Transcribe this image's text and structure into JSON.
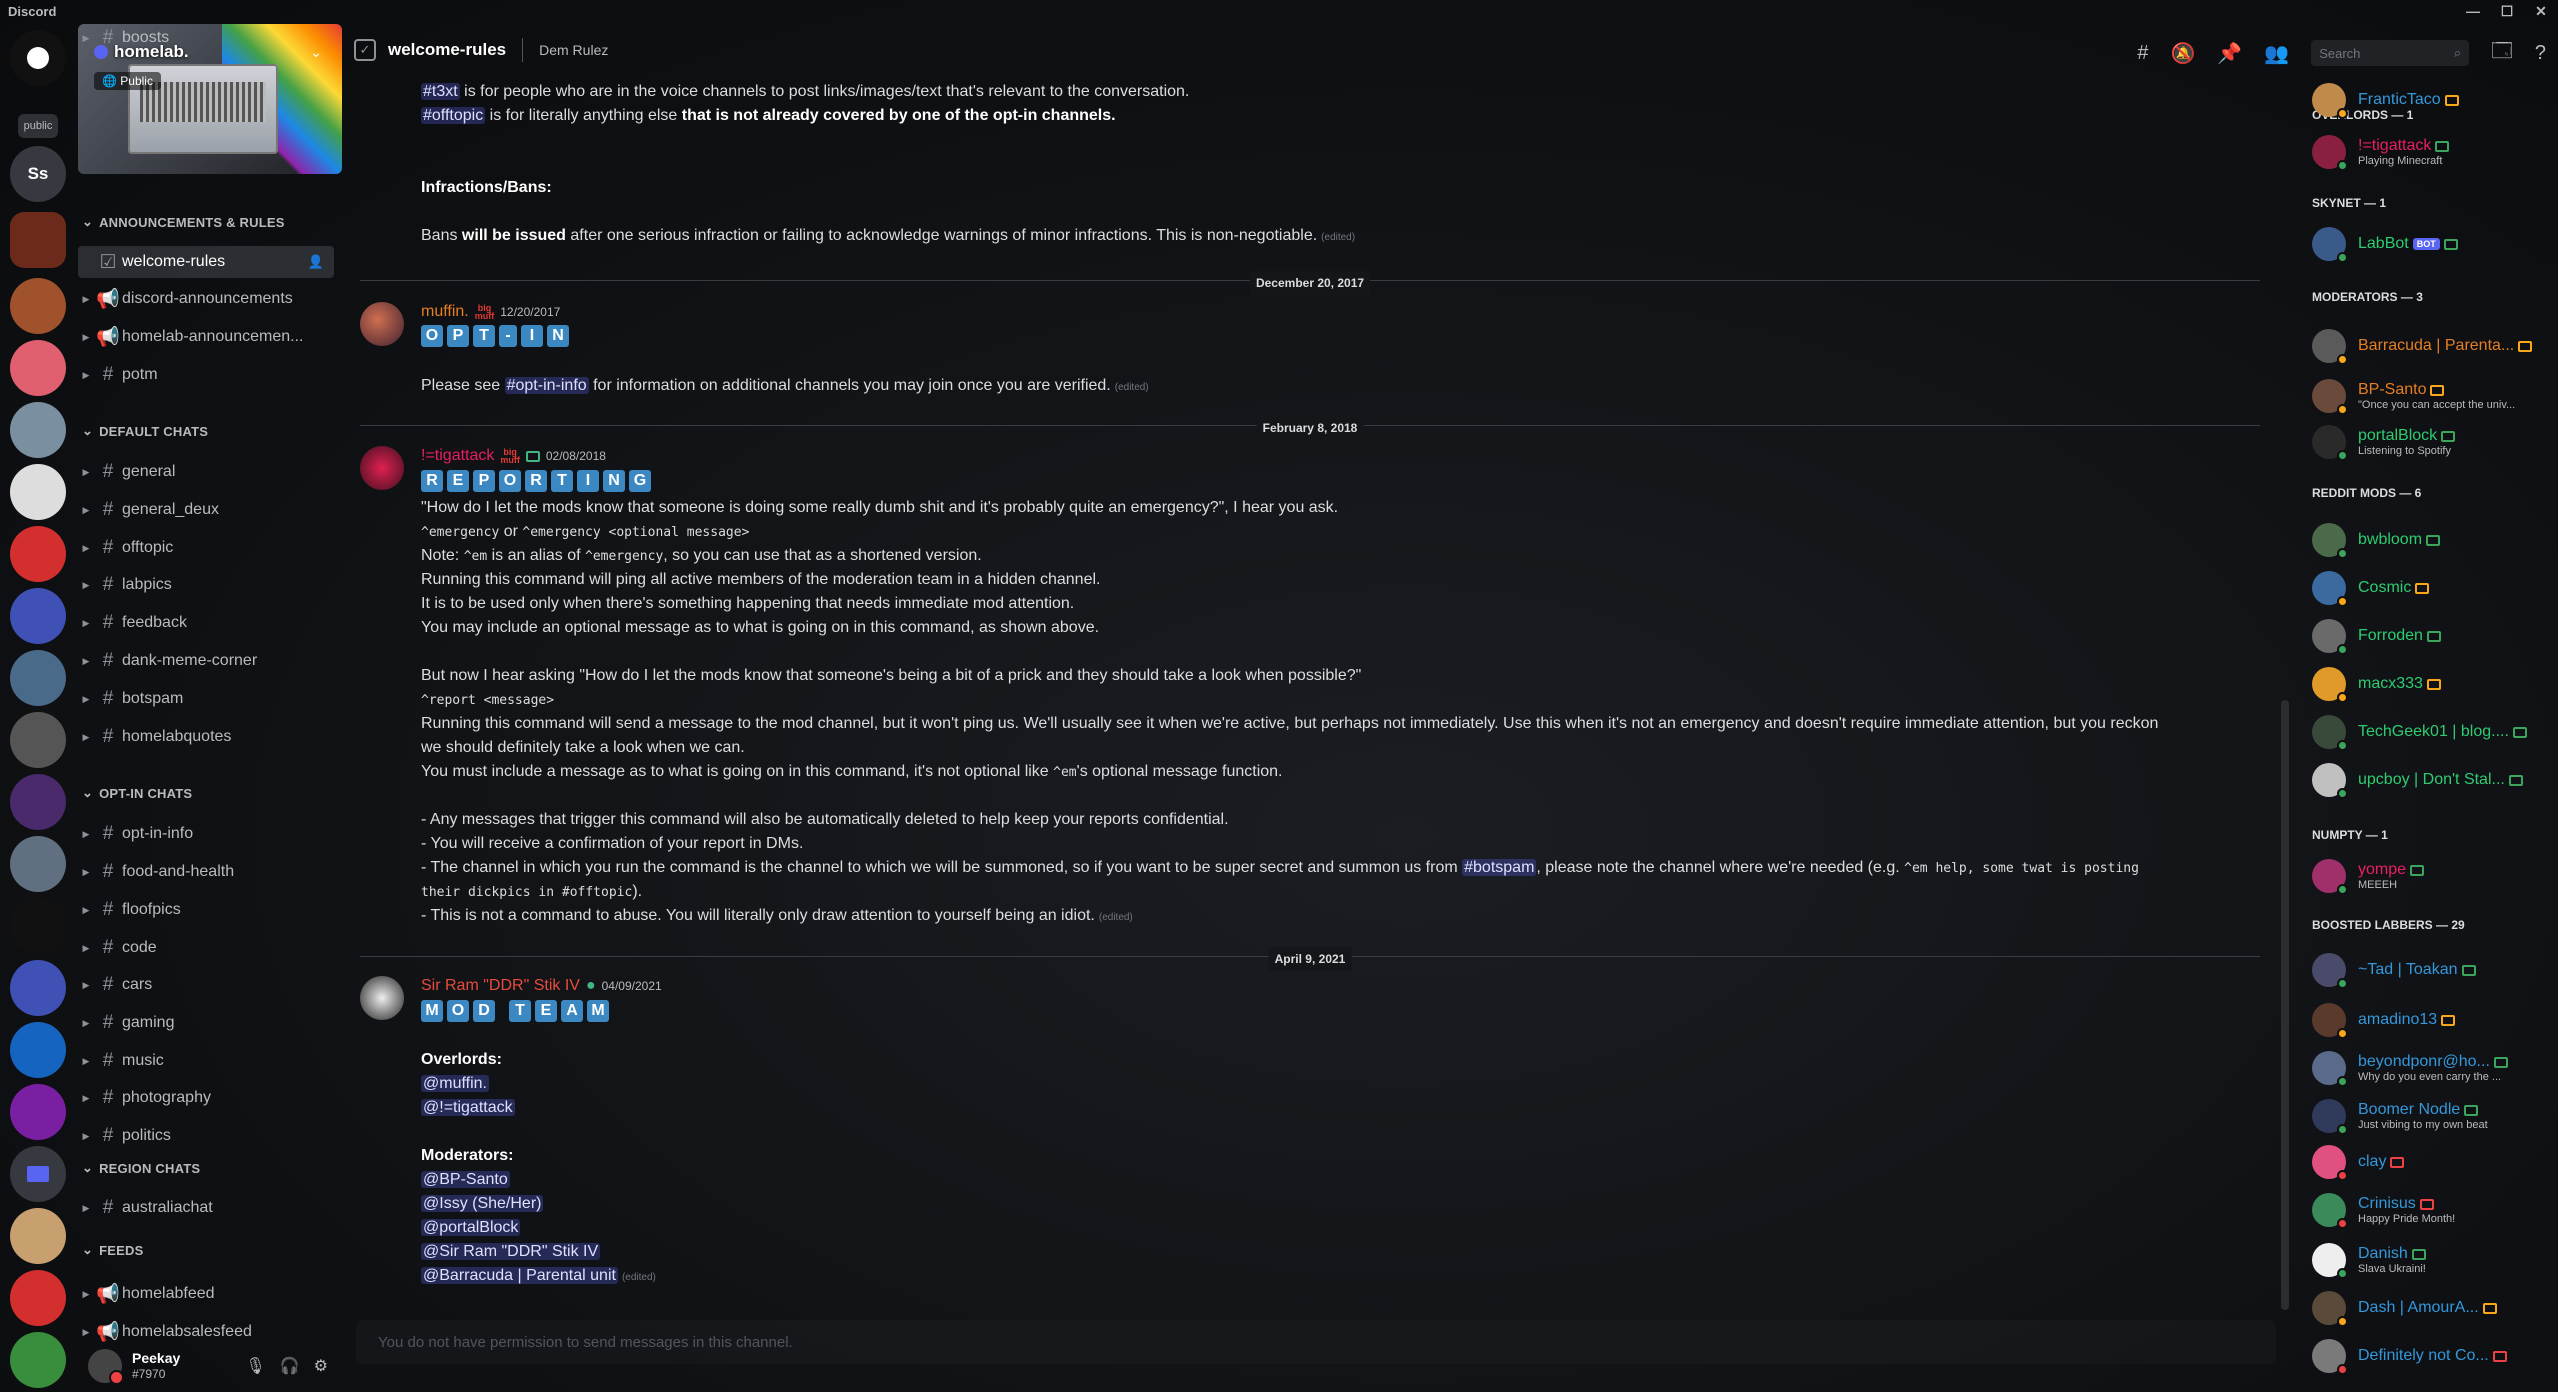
{
  "app": {
    "title": "Discord",
    "controls": [
      "—",
      "☐",
      "✕"
    ]
  },
  "rail": {
    "public_badge": "public",
    "initials_server": "Ss"
  },
  "server": {
    "name": "homelab.",
    "public_label": "Public"
  },
  "categories": [
    {
      "label": "ANNOUNCEMENTS & RULES",
      "channels": [
        {
          "name": "welcome-rules",
          "type": "rules",
          "active": true
        },
        {
          "name": "discord-announcements",
          "type": "announce"
        },
        {
          "name": "homelab-announcemen...",
          "type": "announce"
        },
        {
          "name": "potm",
          "type": "text"
        },
        {
          "name": "boosts",
          "type": "text"
        }
      ]
    },
    {
      "label": "DEFAULT CHATS",
      "channels": [
        {
          "name": "general"
        },
        {
          "name": "general_deux"
        },
        {
          "name": "offtopic"
        },
        {
          "name": "labpics"
        },
        {
          "name": "feedback"
        },
        {
          "name": "dank-meme-corner"
        },
        {
          "name": "botspam"
        },
        {
          "name": "homelabquotes"
        }
      ]
    },
    {
      "label": "OPT-IN CHATS",
      "channels": [
        {
          "name": "opt-in-info"
        },
        {
          "name": "food-and-health"
        },
        {
          "name": "floofpics"
        },
        {
          "name": "code"
        },
        {
          "name": "cars"
        },
        {
          "name": "gaming"
        },
        {
          "name": "music"
        },
        {
          "name": "photography"
        },
        {
          "name": "politics"
        }
      ]
    },
    {
      "label": "REGION CHATS",
      "channels": [
        {
          "name": "australiachat"
        }
      ]
    },
    {
      "label": "FEEDS",
      "channels": [
        {
          "name": "homelabfeed"
        },
        {
          "name": "homelabsalesfeed"
        }
      ]
    }
  ],
  "user": {
    "name": "Peekay",
    "tag": "#7970"
  },
  "header": {
    "channel": "welcome-rules",
    "topic": "Dem Rulez",
    "search_placeholder": "Search"
  },
  "messages": {
    "top": {
      "l1_mention": "#t3xt",
      "l1_text": " is for people who are in the voice channels to post links/images/text that's relevant to the conversation.",
      "l2_mention": "#offtopic",
      "l2_text": " is for literally anything else ",
      "l2_bold": "that is not already covered by one of the opt-in channels.",
      "infractions_heading": "Infractions/Bans:",
      "bans_a": "Bans ",
      "bans_b": "will be issued",
      "bans_c": " after one serious infraction or failing to acknowledge warnings of minor infractions. This is non-negotiable.",
      "edited": "(edited)"
    },
    "dates": [
      "December 20, 2017",
      "February 8, 2018",
      "April 9, 2021"
    ],
    "optin": {
      "author": "muffin.",
      "author_color": "#e67e22",
      "timestamp": "12/20/2017",
      "tiles": [
        "O",
        "P",
        "T",
        "-",
        "I",
        "N"
      ],
      "text_a": "Please see ",
      "mention": "#opt-in-info",
      "text_b": " for information on additional channels you may join once you are verified.",
      "edited": "(edited)"
    },
    "reporting": {
      "author": "!=tigattack",
      "author_color": "#e91e63",
      "timestamp": "02/08/2018",
      "tiles": [
        "R",
        "E",
        "P",
        "O",
        "R",
        "T",
        "I",
        "N",
        "G"
      ],
      "l1": "\"How do I let the mods know that someone is doing some really dumb shit and it's probably quite an emergency?\", I hear you ask.",
      "l2_code": "^emergency",
      "l2_or": " or ",
      "l2_code2": "^emergency <optional message>",
      "l3_a": "Note: ",
      "l3_code": "^em",
      "l3_b": " is an alias of ",
      "l3_code2": "^emergency",
      "l3_c": ", so you can use that as a shortened version.",
      "l4": "Running this command will ping all active members of the moderation team in a hidden channel.",
      "l5": "It is to be used only when there's something happening that needs immediate mod attention.",
      "l6": "You may include an optional message as to what is going on in this command, as shown above.",
      "l7": "But now I hear asking \"How do I let the mods know that someone's being a bit of a prick and they should take a look when possible?\"",
      "l8_code": "^report <message>",
      "l9": "Running this command will send a message to the mod channel, but it won't ping us. We'll usually see it when we're active, but perhaps not immediately. Use this when it's not an emergency and doesn't require immediate attention, but you reckon",
      "l10": "we should definitely take a look when we can.",
      "l11_a": "You must include a message as to what is going on in this command, it's not optional like ",
      "l11_code": "^em",
      "l11_b": "'s optional message function.",
      "l12": "- Any messages that trigger this command will also be automatically deleted to help keep your reports confidential.",
      "l13": "- You will receive a confirmation of your report in DMs.",
      "l14_a": "- The channel in which you run the command is the channel to which we will be summoned, so if you want to be super secret and summon us from ",
      "l14_mention": "#botspam",
      "l14_b": ", please note the channel where we're needed (e.g. ",
      "l14_code": "^em help, some twat is posting",
      "l15_code": "their dickpics in #offtopic",
      "l15_b": ").",
      "l16": "- This is not a command to abuse. You will literally only draw attention to yourself being an idiot.",
      "edited": "(edited)"
    },
    "modteam": {
      "author": "Sir Ram \"DDR\" Stik IV",
      "author_color": "#e74c3c",
      "timestamp": "04/09/2021",
      "tiles": [
        "M",
        "O",
        "D",
        " ",
        "T",
        "E",
        "A",
        "M"
      ],
      "overlords": "Overlords:",
      "o1": "@muffin.",
      "o2": "@!=tigattack",
      "moderators": "Moderators:",
      "m1": "@BP-Santo",
      "m2": "@Issy (She/Her)",
      "m3": "@portalBlock",
      "m4": "@Sir Ram \"DDR\" Stik IV",
      "m5": "@Barracuda | Parental unit",
      "edited": "(edited)"
    }
  },
  "compose_placeholder": "You do not have permission to send messages in this channel.",
  "member_groups": [
    {
      "label": "OVERLORDS — 1",
      "members": [
        {
          "name": "!=tigattack",
          "color": "#e91e63",
          "status": "Playing Minecraft",
          "presence": "online"
        }
      ]
    },
    {
      "label": "SKYNET — 1",
      "members": [
        {
          "name": "LabBot",
          "color": "#2ecc71",
          "bot": "BOT",
          "presence": "online"
        }
      ]
    },
    {
      "label": "MODERATORS — 3",
      "members": [
        {
          "name": "Barracuda | Parenta...",
          "color": "#e67e22",
          "presence": "idle"
        },
        {
          "name": "BP-Santo",
          "color": "#e67e22",
          "status": "\"Once you can accept the univ...",
          "presence": "idle"
        },
        {
          "name": "portalBlock",
          "color": "#2ecc71",
          "status": "Listening to Spotify",
          "presence": "online"
        }
      ]
    },
    {
      "label": "REDDIT MODS — 6",
      "members": [
        {
          "name": "bwbloom",
          "color": "#2ecc71",
          "presence": "online"
        },
        {
          "name": "Cosmic",
          "color": "#2ecc71",
          "presence": "idle"
        },
        {
          "name": "Forroden",
          "color": "#2ecc71",
          "presence": "online"
        },
        {
          "name": "macx333",
          "color": "#2ecc71",
          "presence": "idle"
        },
        {
          "name": "TechGeek01 | blog....",
          "color": "#2ecc71",
          "presence": "online"
        },
        {
          "name": "upcboy | Don't Stal...",
          "color": "#2ecc71",
          "presence": "online"
        }
      ]
    },
    {
      "label": "NUMPTY — 1",
      "members": [
        {
          "name": "yompe",
          "color": "#e91e63",
          "status": "MEEEH",
          "presence": "online"
        }
      ]
    },
    {
      "label": "BOOSTED LABBERS — 29",
      "members": [
        {
          "name": "~Tad | Toakan",
          "color": "#3498db",
          "presence": "online"
        },
        {
          "name": "amadino13",
          "color": "#3498db",
          "presence": "idle"
        },
        {
          "name": "beyondponr@ho...",
          "color": "#3498db",
          "status": "Why do you even carry the ...",
          "presence": "online"
        },
        {
          "name": "Boomer Nodle",
          "color": "#3498db",
          "status": "Just vibing to my own beat",
          "presence": "online"
        },
        {
          "name": "clay",
          "color": "#3498db",
          "presence": "dnd"
        },
        {
          "name": "Crinisus",
          "color": "#3498db",
          "status": "Happy Pride Month!",
          "presence": "dnd"
        },
        {
          "name": "Danish",
          "color": "#3498db",
          "status": "Slava Ukraini!",
          "presence": "online"
        },
        {
          "name": "Dash | AmourA...",
          "color": "#3498db",
          "presence": "idle"
        },
        {
          "name": "Definitely not Co...",
          "color": "#3498db",
          "presence": "dnd"
        },
        {
          "name": "FranticTaco",
          "color": "#3498db",
          "presence": "idle"
        }
      ]
    }
  ]
}
